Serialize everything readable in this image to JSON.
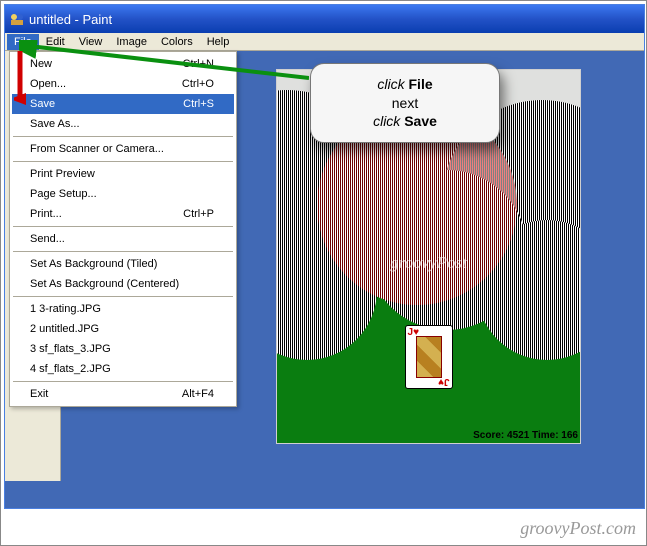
{
  "window": {
    "title": "untitled - Paint"
  },
  "menubar": {
    "items": [
      "File",
      "Edit",
      "View",
      "Image",
      "Colors",
      "Help"
    ],
    "active_index": 0
  },
  "file_menu": {
    "items": [
      {
        "label": "New",
        "shortcut": "Ctrl+N",
        "hl": false
      },
      {
        "label": "Open...",
        "shortcut": "Ctrl+O",
        "hl": false
      },
      {
        "label": "Save",
        "shortcut": "Ctrl+S",
        "hl": true
      },
      {
        "label": "Save As...",
        "shortcut": "",
        "hl": false
      },
      {
        "sep": true
      },
      {
        "label": "From Scanner or Camera...",
        "shortcut": "",
        "hl": false
      },
      {
        "sep": true
      },
      {
        "label": "Print Preview",
        "shortcut": "",
        "hl": false
      },
      {
        "label": "Page Setup...",
        "shortcut": "",
        "hl": false
      },
      {
        "label": "Print...",
        "shortcut": "Ctrl+P",
        "hl": false
      },
      {
        "sep": true
      },
      {
        "label": "Send...",
        "shortcut": "",
        "hl": false
      },
      {
        "sep": true
      },
      {
        "label": "Set As Background (Tiled)",
        "shortcut": "",
        "hl": false
      },
      {
        "label": "Set As Background (Centered)",
        "shortcut": "",
        "hl": false
      },
      {
        "sep": true
      },
      {
        "label": "1 3-rating.JPG",
        "shortcut": "",
        "hl": false
      },
      {
        "label": "2 untitled.JPG",
        "shortcut": "",
        "hl": false
      },
      {
        "label": "3 sf_flats_3.JPG",
        "shortcut": "",
        "hl": false
      },
      {
        "label": "4 sf_flats_2.JPG",
        "shortcut": "",
        "hl": false
      },
      {
        "sep": true
      },
      {
        "label": "Exit",
        "shortcut": "Alt+F4",
        "hl": false
      }
    ]
  },
  "canvas": {
    "card_rank": "J",
    "card_suit": "♥",
    "status": "Score: 4521 Time: 166",
    "watermark": "groovyPost"
  },
  "callout": {
    "line1_prefix": "click ",
    "line1_bold": "File",
    "line2": "next",
    "line3_prefix": "click ",
    "line3_bold": "Save"
  },
  "brand": "groovyPost.com"
}
